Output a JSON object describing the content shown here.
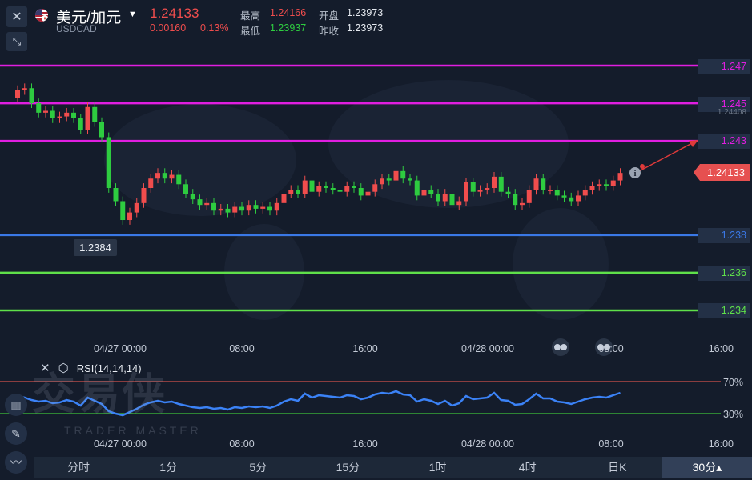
{
  "header": {
    "close_icon": "close-icon",
    "compress_icon": "compress-icon",
    "pair_name": "美元/加元",
    "pair_code": "USDCAD",
    "price": "1.24133",
    "change_abs": "0.00160",
    "change_pct": "0.13%",
    "high_label": "最高",
    "high_value": "1.24166",
    "low_label": "最低",
    "low_value": "1.23937",
    "open_label": "开盘",
    "open_value": "1.23973",
    "prev_close_label": "昨收",
    "prev_close_value": "1.23973"
  },
  "colors": {
    "up": "#f04d4d",
    "down": "#2ecc40",
    "magenta_level": "#e01ee0",
    "blue_level": "#3a78e6",
    "green_level": "#5fe04a",
    "rsi_line": "#3b82f6",
    "rsi_upper": "#d0514b",
    "rsi_lower": "#3fc43b"
  },
  "price_tags": {
    "l1": "1.247",
    "l2": "1.245",
    "l3": "1.243",
    "l4": "1.238",
    "l5": "1.236",
    "l6": "1.234",
    "faint": "1.24408",
    "last": "1.24133",
    "low_marker": "1.2384"
  },
  "time_axis": [
    "04/27 00:00",
    "08:00",
    "16:00",
    "04/28 00:00",
    "08:00",
    "16:00"
  ],
  "indicator": {
    "rsi_label": "RSI(14,14,14)",
    "upper_label": "70%",
    "lower_label": "30%"
  },
  "watermark": {
    "main": "交易侠",
    "sub": "TRADER MASTER"
  },
  "timeframes": [
    "分时",
    "1分",
    "5分",
    "15分",
    "1时",
    "4时",
    "日K",
    "30分▴"
  ],
  "chart_data": {
    "type": "candlestick",
    "title": "美元/加元",
    "interval": "30分",
    "x_tick_labels": [
      "04/27 00:00",
      "08:00",
      "16:00",
      "04/28 00:00",
      "08:00",
      "16:00"
    ],
    "ylim": [
      1.233,
      1.248
    ],
    "horizontal_levels": [
      {
        "value": 1.247,
        "color": "magenta"
      },
      {
        "value": 1.245,
        "color": "magenta"
      },
      {
        "value": 1.243,
        "color": "magenta"
      },
      {
        "value": 1.238,
        "color": "blue"
      },
      {
        "value": 1.236,
        "color": "green"
      },
      {
        "value": 1.234,
        "color": "green"
      }
    ],
    "last_price": 1.24133,
    "marked_low": 1.2384,
    "closes": [
      1.2457,
      1.2458,
      1.245,
      1.2445,
      1.2446,
      1.2442,
      1.2443,
      1.2445,
      1.2442,
      1.2436,
      1.2448,
      1.244,
      1.2432,
      1.2405,
      1.2398,
      1.2388,
      1.2392,
      1.2397,
      1.2405,
      1.241,
      1.2413,
      1.241,
      1.2412,
      1.2407,
      1.2402,
      1.2399,
      1.2396,
      1.2397,
      1.2393,
      1.2394,
      1.2392,
      1.2395,
      1.2393,
      1.2396,
      1.2394,
      1.2395,
      1.2393,
      1.2397,
      1.2402,
      1.2404,
      1.2402,
      1.2409,
      1.2403,
      1.2406,
      1.2405,
      1.2404,
      1.2403,
      1.2406,
      1.2405,
      1.2401,
      1.2403,
      1.2407,
      1.241,
      1.2409,
      1.2414,
      1.241,
      1.2409,
      1.2401,
      1.2404,
      1.2402,
      1.2398,
      1.2402,
      1.2396,
      1.2398,
      1.2408,
      1.2403,
      1.2404,
      1.2405,
      1.2411,
      1.2403,
      1.2402,
      1.2396,
      1.2397,
      1.2404,
      1.241,
      1.2404,
      1.2404,
      1.2401,
      1.24,
      1.2398,
      1.2401,
      1.2404,
      1.2406,
      1.2407,
      1.2406,
      1.2409,
      1.2413
    ],
    "rsi": [
      52,
      50,
      47,
      45,
      46,
      43,
      44,
      47,
      45,
      40,
      50,
      46,
      42,
      33,
      30,
      28,
      32,
      36,
      41,
      44,
      46,
      44,
      45,
      42,
      40,
      38,
      37,
      38,
      36,
      37,
      35,
      38,
      37,
      39,
      38,
      39,
      37,
      40,
      45,
      48,
      46,
      55,
      50,
      53,
      52,
      51,
      50,
      53,
      52,
      48,
      50,
      54,
      56,
      55,
      58,
      54,
      53,
      45,
      48,
      46,
      42,
      46,
      40,
      43,
      52,
      48,
      49,
      50,
      56,
      47,
      46,
      41,
      42,
      48,
      55,
      49,
      49,
      45,
      44,
      42,
      45,
      48,
      50,
      51,
      50,
      53,
      56
    ]
  }
}
